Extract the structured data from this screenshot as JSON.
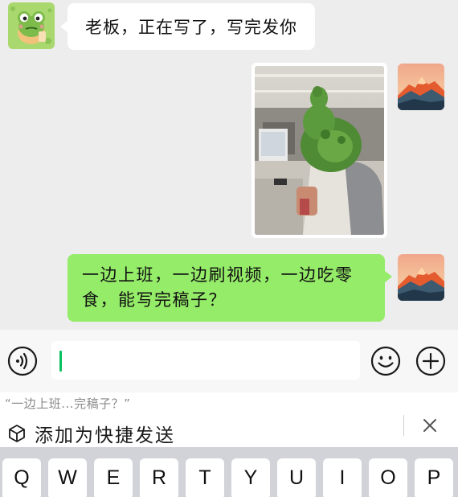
{
  "chat": {
    "incoming_message": "老板，正在写了，写完发你",
    "outgoing_photo": "photo-message",
    "outgoing_message_line1": "一边上班，一边刷视频，一边吃零",
    "outgoing_message_line2": "食，能写完稿子？"
  },
  "input_bar": {
    "value": "",
    "voice_icon": "voice-icon",
    "emoji_icon": "emoji-icon",
    "plus_icon": "plus-icon",
    "accent_color": "#07c160"
  },
  "suggestion": {
    "quote": "“一边上班...完稿子？”",
    "action_label": "添加为快捷发送",
    "action_icon": "cube-icon",
    "close_icon": "close-icon"
  },
  "keyboard": {
    "keys": [
      "Q",
      "W",
      "E",
      "R",
      "T",
      "Y",
      "U",
      "I",
      "O",
      "P"
    ]
  },
  "colors": {
    "chat_background": "#ededed",
    "outgoing_bubble": "#95ec69",
    "incoming_bubble": "#ffffff",
    "keyboard_background": "#d1d3d9"
  }
}
